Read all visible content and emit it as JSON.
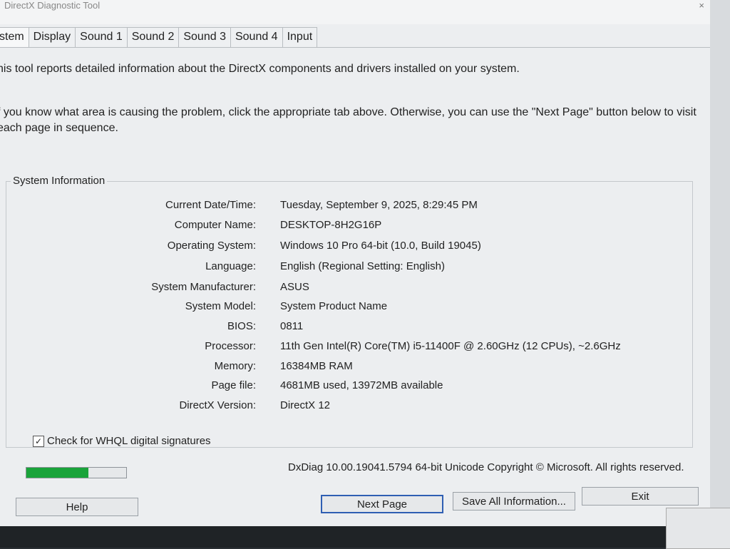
{
  "window": {
    "title": "DirectX Diagnostic Tool",
    "close_glyph": "×"
  },
  "tabs": [
    "stem",
    "Display",
    "Sound 1",
    "Sound 2",
    "Sound 3",
    "Sound 4",
    "Input"
  ],
  "intro": {
    "line1": "his tool reports detailed information about the DirectX components and drivers installed on your system.",
    "line2": "f you know what area is causing the problem, click the appropriate tab above.  Otherwise, you can use the \"Next Page\" button below to visit each page in sequence."
  },
  "system_info": {
    "title": "System Information",
    "rows": [
      {
        "label": "Current Date/Time:",
        "value": "Tuesday, September 9, 2025, 8:29:45 PM"
      },
      {
        "label": "Computer Name:",
        "value": "DESKTOP-8H2G16P"
      },
      {
        "label": "Operating System:",
        "value": "Windows 10 Pro 64-bit (10.0, Build 19045)"
      },
      {
        "label": "Language:",
        "value": "English (Regional Setting: English)"
      },
      {
        "label": "System Manufacturer:",
        "value": "ASUS"
      },
      {
        "label": "System Model:",
        "value": "System Product Name"
      },
      {
        "label": "BIOS:",
        "value": "0811"
      },
      {
        "label": "Processor:",
        "value": "11th Gen Intel(R) Core(TM) i5-11400F @ 2.60GHz (12 CPUs), ~2.6GHz"
      },
      {
        "label": "Memory:",
        "value": "16384MB RAM"
      },
      {
        "label": "Page file:",
        "value": "4681MB used, 13972MB available"
      },
      {
        "label": "DirectX Version:",
        "value": "DirectX 12"
      }
    ]
  },
  "whql": {
    "label": "Check for WHQL digital signatures",
    "checked_glyph": "✓"
  },
  "progress": {
    "fraction": 0.62,
    "color": "#1aa33a"
  },
  "copyright": "DxDiag 10.00.19041.5794 64-bit Unicode  Copyright © Microsoft. All rights reserved.",
  "buttons": {
    "help": "Help",
    "next_page": "Next Page",
    "save_all": "Save All Information...",
    "exit": "Exit"
  }
}
